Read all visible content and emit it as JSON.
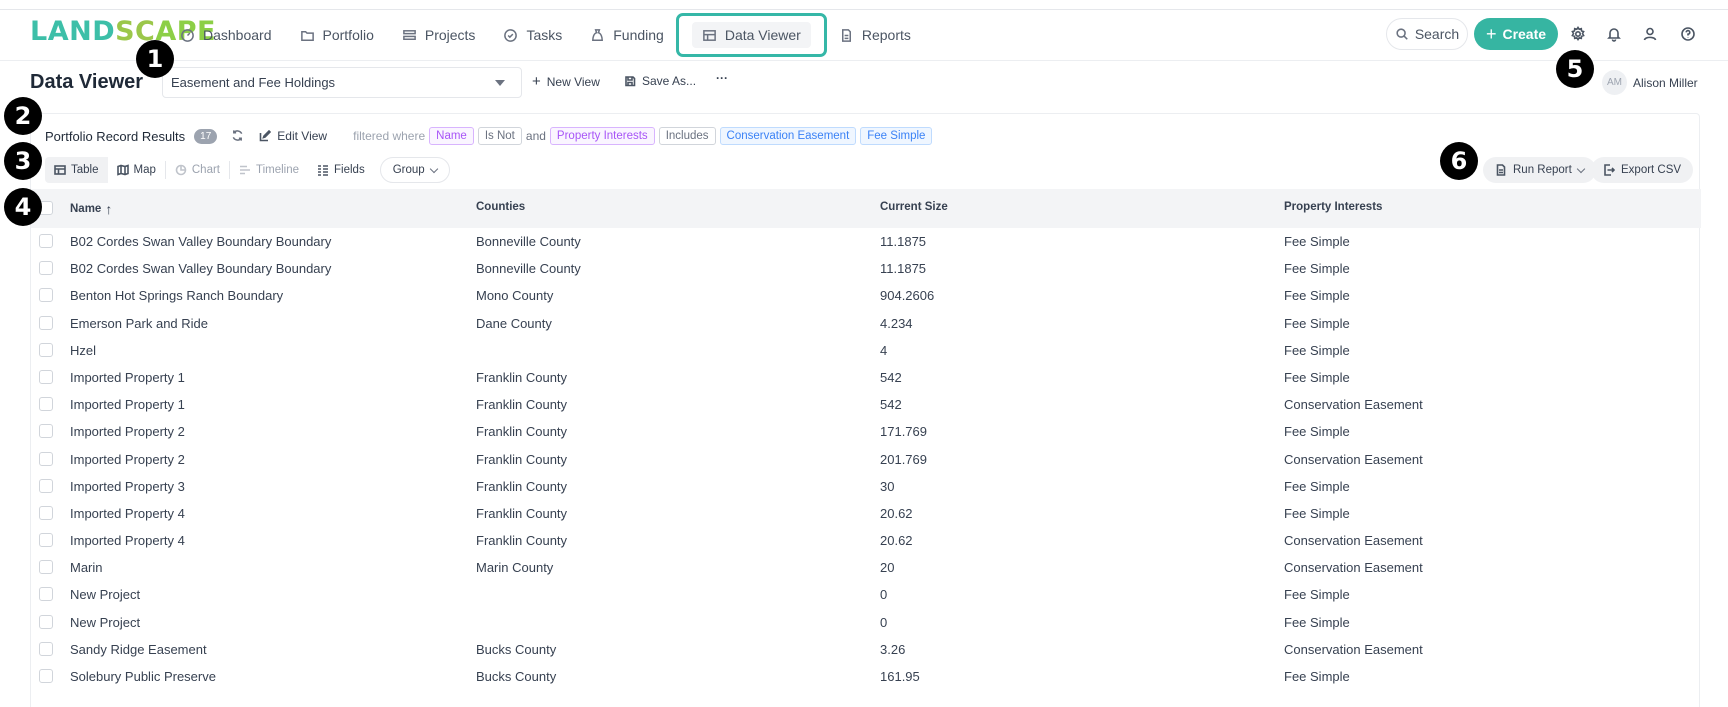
{
  "app": {
    "logo": "LANDSCAPE",
    "nav": [
      {
        "label": "Dashboard",
        "icon": "dashboard-icon"
      },
      {
        "label": "Portfolio",
        "icon": "folder-icon"
      },
      {
        "label": "Projects",
        "icon": "projects-icon"
      },
      {
        "label": "Tasks",
        "icon": "check-circle-icon"
      },
      {
        "label": "Funding",
        "icon": "funding-icon"
      },
      {
        "label": "Data Viewer",
        "icon": "table-icon",
        "active": true
      },
      {
        "label": "Reports",
        "icon": "document-icon"
      }
    ],
    "search_label": "Search",
    "create_label": "Create",
    "brand_color": "#36b5a2"
  },
  "page": {
    "title": "Data Viewer",
    "selected_view": "Easement and Fee Holdings",
    "new_view_label": "New View",
    "save_as_label": "Save As...",
    "more_label": "···",
    "user_initials": "AM",
    "user_name": "Alison Miller"
  },
  "results": {
    "title": "Portfolio Record Results",
    "count": "17",
    "edit_view_label": "Edit View",
    "filter_prefix": "filtered where",
    "filter": {
      "field1": "Name",
      "op1": "Is Not",
      "and": "and",
      "field2": "Property Interests",
      "op2": "Includes",
      "value_a": "Conservation Easement",
      "value_b": "Fee Simple"
    }
  },
  "toolbar": {
    "table": "Table",
    "map": "Map",
    "chart": "Chart",
    "timeline": "Timeline",
    "fields": "Fields",
    "group": "Group",
    "run_report": "Run Report",
    "export_csv": "Export CSV"
  },
  "table": {
    "columns": [
      "Name",
      "Counties",
      "Current Size",
      "Property Interests"
    ],
    "rows": [
      [
        "B02 Cordes Swan Valley Boundary Boundary",
        "Bonneville County",
        "11.1875",
        "Fee Simple"
      ],
      [
        "B02 Cordes Swan Valley Boundary Boundary",
        "Bonneville County",
        "11.1875",
        "Fee Simple"
      ],
      [
        "Benton Hot Springs Ranch Boundary",
        "Mono County",
        "904.2606",
        "Fee Simple"
      ],
      [
        "Emerson Park and Ride",
        "Dane County",
        "4.234",
        "Fee Simple"
      ],
      [
        "Hzel",
        "",
        "4",
        "Fee Simple"
      ],
      [
        "Imported Property 1",
        "Franklin County",
        "542",
        "Fee Simple"
      ],
      [
        "Imported Property 1",
        "Franklin County",
        "542",
        "Conservation Easement"
      ],
      [
        "Imported Property 2",
        "Franklin County",
        "171.769",
        "Fee Simple"
      ],
      [
        "Imported Property 2",
        "Franklin County",
        "201.769",
        "Conservation Easement"
      ],
      [
        "Imported Property 3",
        "Franklin County",
        "30",
        "Fee Simple"
      ],
      [
        "Imported Property 4",
        "Franklin County",
        "20.62",
        "Fee Simple"
      ],
      [
        "Imported Property 4",
        "Franklin County",
        "20.62",
        "Conservation Easement"
      ],
      [
        "Marin",
        "Marin County",
        "20",
        "Conservation Easement"
      ],
      [
        "New Project",
        "",
        "0",
        "Fee Simple"
      ],
      [
        "New Project",
        "",
        "0",
        "Fee Simple"
      ],
      [
        "Sandy Ridge Easement",
        "Bucks County",
        "3.26",
        "Conservation Easement"
      ],
      [
        "Solebury Public Preserve",
        "Bucks County",
        "161.95",
        "Fee Simple"
      ]
    ]
  },
  "markers": [
    "1",
    "2",
    "3",
    "4",
    "5",
    "6"
  ]
}
